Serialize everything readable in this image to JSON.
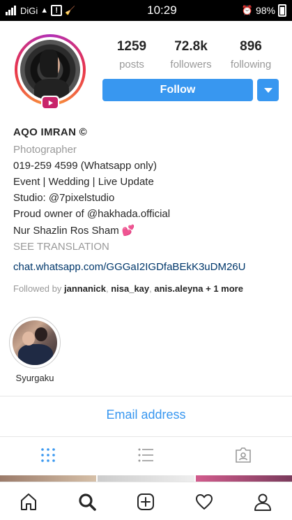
{
  "status_bar": {
    "carrier": "DiGi",
    "time": "10:29",
    "battery": "98%"
  },
  "profile": {
    "stats": [
      {
        "count": "1259",
        "label": "posts"
      },
      {
        "count": "72.8k",
        "label": "followers"
      },
      {
        "count": "896",
        "label": "following"
      }
    ],
    "follow_label": "Follow",
    "name": "AQO IMRAN ©",
    "category": "Photographer",
    "bio_lines": [
      "019-259 4599 (Whatsapp only)",
      "Event | Wedding | Live Update",
      "Studio: @7pixelstudio",
      "Proud owner of @hakhada.official",
      "Nur Shazlin Ros Sham 💕"
    ],
    "see_translation": "SEE TRANSLATION",
    "link": "chat.whatsapp.com/GGGaI2IGDfaBEkK3uDM26U",
    "followed_by": {
      "prefix": "Followed by",
      "users": [
        "jannanick",
        "nisa_kay",
        "anis.aleyna"
      ],
      "suffix": "+ 1 more"
    }
  },
  "highlights": [
    {
      "label": "Syurgaku"
    }
  ],
  "email_label": "Email address",
  "tabs": [
    {
      "icon": "grid-icon",
      "active": true
    },
    {
      "icon": "list-icon",
      "active": false
    },
    {
      "icon": "tagged-icon",
      "active": false
    }
  ],
  "bottom_nav": [
    {
      "icon": "home-icon"
    },
    {
      "icon": "search-icon",
      "active": true
    },
    {
      "icon": "add-post-icon"
    },
    {
      "icon": "heart-icon"
    },
    {
      "icon": "profile-icon"
    }
  ],
  "colors": {
    "accent": "#3897f0",
    "link": "#00376b",
    "muted": "#999999",
    "text": "#262626"
  }
}
